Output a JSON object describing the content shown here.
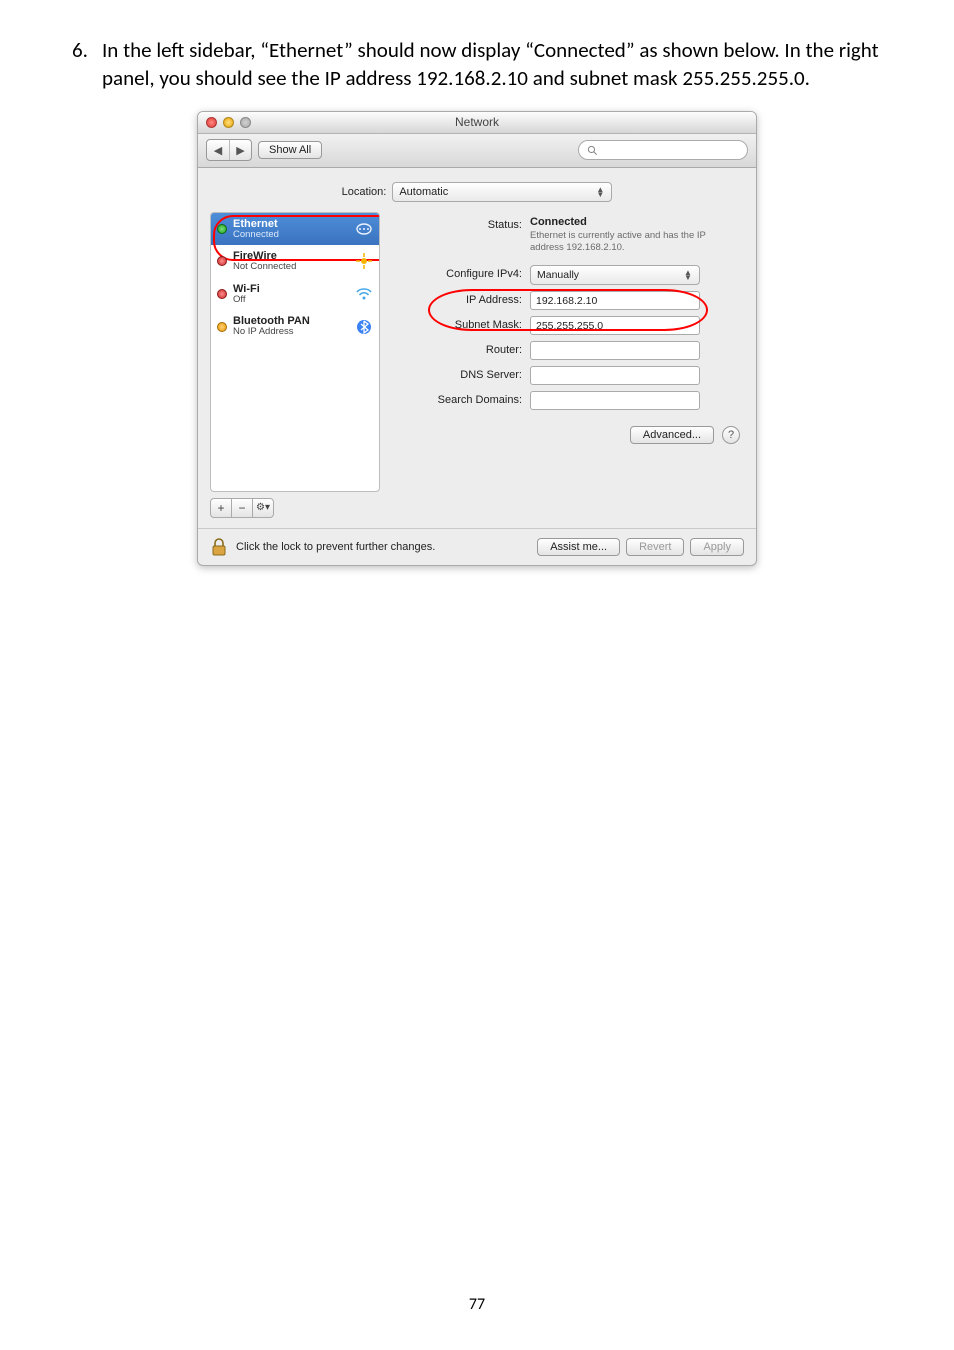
{
  "instruction": {
    "number": "6.",
    "text": "In the left sidebar, “Ethernet” should now display “Connected” as shown below. In the right panel, you should see the IP address 192.168.2.10 and subnet mask 255.255.255.0."
  },
  "window": {
    "title": "Network",
    "toolbar": {
      "show_all": "Show All",
      "search_placeholder": ""
    },
    "location": {
      "label": "Location:",
      "value": "Automatic"
    },
    "sidebar": {
      "interfaces": [
        {
          "name": "Ethernet",
          "sub": "Connected",
          "status": "green",
          "icon": "ethernet-icon",
          "selected": true
        },
        {
          "name": "FireWire",
          "sub": "Not Connected",
          "status": "red",
          "icon": "firewire-icon",
          "selected": false
        },
        {
          "name": "Wi-Fi",
          "sub": "Off",
          "status": "red",
          "icon": "wifi-icon",
          "selected": false
        },
        {
          "name": "Bluetooth PAN",
          "sub": "No IP Address",
          "status": "orange",
          "icon": "bluetooth-icon",
          "selected": false
        }
      ],
      "add": "+",
      "remove": "−",
      "gear": "⚙▾"
    },
    "main": {
      "status_label": "Status:",
      "status_value": "Connected",
      "status_desc": "Ethernet is currently active and has the IP address 192.168.2.10.",
      "configure_label": "Configure IPv4:",
      "configure_value": "Manually",
      "ip_label": "IP Address:",
      "ip_value": "192.168.2.10",
      "subnet_label": "Subnet Mask:",
      "subnet_value": "255.255.255.0",
      "router_label": "Router:",
      "router_value": "",
      "dns_label": "DNS Server:",
      "dns_value": "",
      "domains_label": "Search Domains:",
      "domains_value": "",
      "advanced": "Advanced...",
      "help": "?"
    },
    "footer": {
      "lock_text": "Click the lock to prevent further changes.",
      "assist": "Assist me...",
      "revert": "Revert",
      "apply": "Apply"
    }
  },
  "page_number": "77"
}
